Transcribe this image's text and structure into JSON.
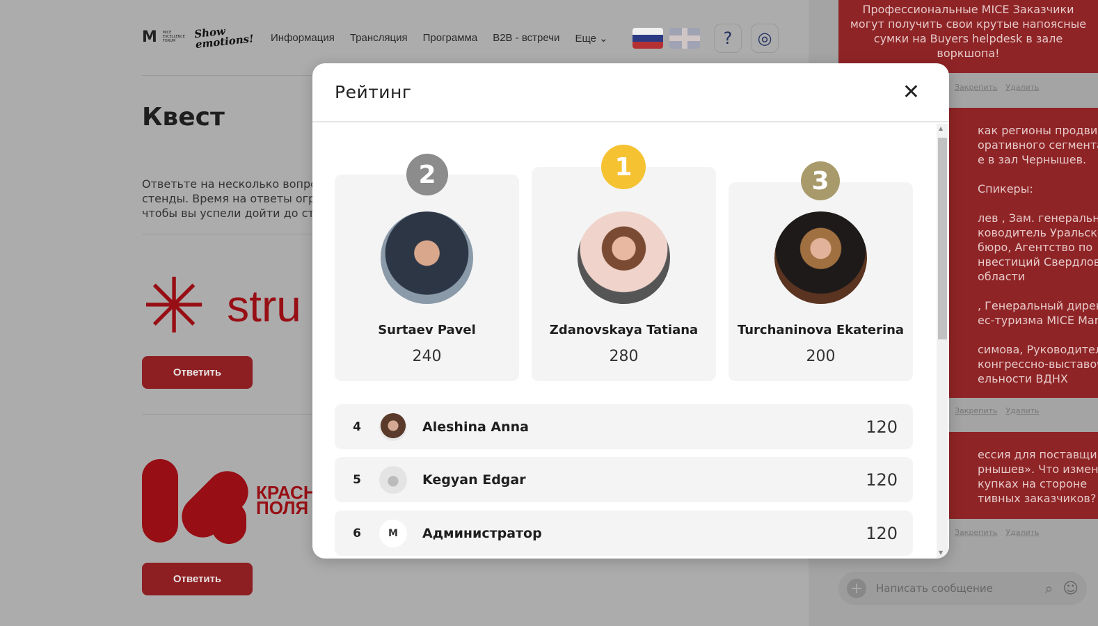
{
  "header": {
    "logo_text": "MICE EXCELLENCE FORUM",
    "slogan": "Show emotions!",
    "nav": [
      "Информация",
      "Трансляция",
      "Программа",
      "B2B - встречи",
      "Еще"
    ],
    "help": "?"
  },
  "page": {
    "title": "Квест",
    "description": [
      "Ответьте на несколько вопро",
      "стенды. Время на ответы огра",
      "чтобы вы успели дойти до сте"
    ],
    "answer_label": "Ответить",
    "sponsors": [
      "stru",
      "КРАСН",
      "ПОЛЯ"
    ]
  },
  "chat": {
    "messages": [
      {
        "lines": [
          "Профессиональные MICE Заказчики",
          "могут получить свои крутые напоясные",
          "сумки на Buyers helpdesk в зале",
          "воркшопа!"
        ]
      },
      {
        "lines": [
          "как регионы продвигают",
          "оративного сегмента?",
          "е в зал Чернышев.",
          "",
          "Спикеры:",
          "",
          "лев , Зам. генерального",
          "ководитель Уральского",
          "бюро, Агентство по",
          "нвестиций Свердловской",
          "области",
          "",
          ", Генеральный директор",
          "ес-туризма MICE Market",
          "",
          "симова, Руководитель",
          "конгрессно-выставочной",
          "ельности ВДНХ"
        ]
      },
      {
        "lines": [
          "ессия для поставщиков",
          "рнышев». Что изменилось",
          "купках на стороне",
          "тивных заказчиков?"
        ]
      }
    ],
    "pin": "Закрепить",
    "delete": "Удалить",
    "input_placeholder": "Написать сообщение"
  },
  "modal": {
    "title": "Рейтинг",
    "podium": [
      {
        "rank": "2",
        "name": "Surtaev Pavel",
        "score": "240",
        "color": "#8c8c8c"
      },
      {
        "rank": "1",
        "name": "Zdanovskaya Tatiana",
        "score": "280",
        "color": "#f5c232"
      },
      {
        "rank": "3",
        "name": "Turchaninova Ekaterina",
        "score": "200",
        "color": "#a89a6a"
      }
    ],
    "list": [
      {
        "rank": "4",
        "name": "Aleshina Anna",
        "score": "120"
      },
      {
        "rank": "5",
        "name": "Kegyan Edgar",
        "score": "120"
      },
      {
        "rank": "6",
        "name": "Администратор",
        "score": "120"
      }
    ]
  }
}
